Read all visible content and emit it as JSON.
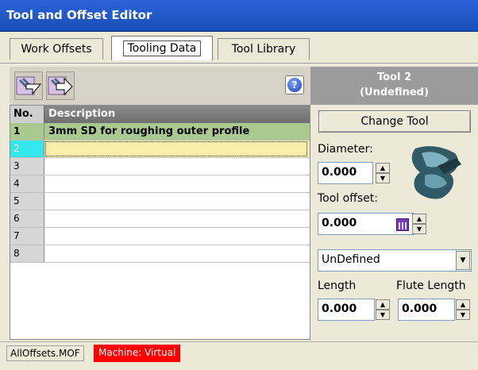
{
  "window": {
    "title": "Tool and Offset Editor"
  },
  "tabs": [
    {
      "label": "Work Offsets",
      "active": false
    },
    {
      "label": "Tooling Data",
      "active": true
    },
    {
      "label": "Tool Library",
      "active": false
    }
  ],
  "toolbar": {
    "import_icon": "arrow-in-icon",
    "export_icon": "arrow-out-icon",
    "help_glyph": "?"
  },
  "grid": {
    "col_no": "No.",
    "col_description": "Description",
    "rows": [
      {
        "no": "1",
        "description": "3mm SD for roughing outer profile"
      },
      {
        "no": "2",
        "description": ""
      },
      {
        "no": "3",
        "description": ""
      },
      {
        "no": "4",
        "description": ""
      },
      {
        "no": "5",
        "description": ""
      },
      {
        "no": "6",
        "description": ""
      },
      {
        "no": "7",
        "description": ""
      },
      {
        "no": "8",
        "description": ""
      }
    ]
  },
  "tool_panel": {
    "header_line1": "Tool 2",
    "header_line2": "(Undefined)",
    "change_tool_label": "Change Tool",
    "diameter_label": "Diameter:",
    "diameter_value": "0.000",
    "tool_offset_label": "Tool offset:",
    "tool_offset_value": "0.000",
    "tool_type_selected": "UnDefined",
    "length_label": "Length",
    "length_value": "0.000",
    "flute_length_label": "Flute Length",
    "flute_length_value": "0.000"
  },
  "status": {
    "file": "AllOffsets.MOF",
    "machine": "Machine: Virtual",
    "machine_color": "#ff0000"
  },
  "colors": {
    "titlebar": "#1a4db8",
    "row_selected_green": "#a9c98f",
    "row_current_yellow": "#fbeeaa",
    "row_current_number": "#35e7ef"
  }
}
